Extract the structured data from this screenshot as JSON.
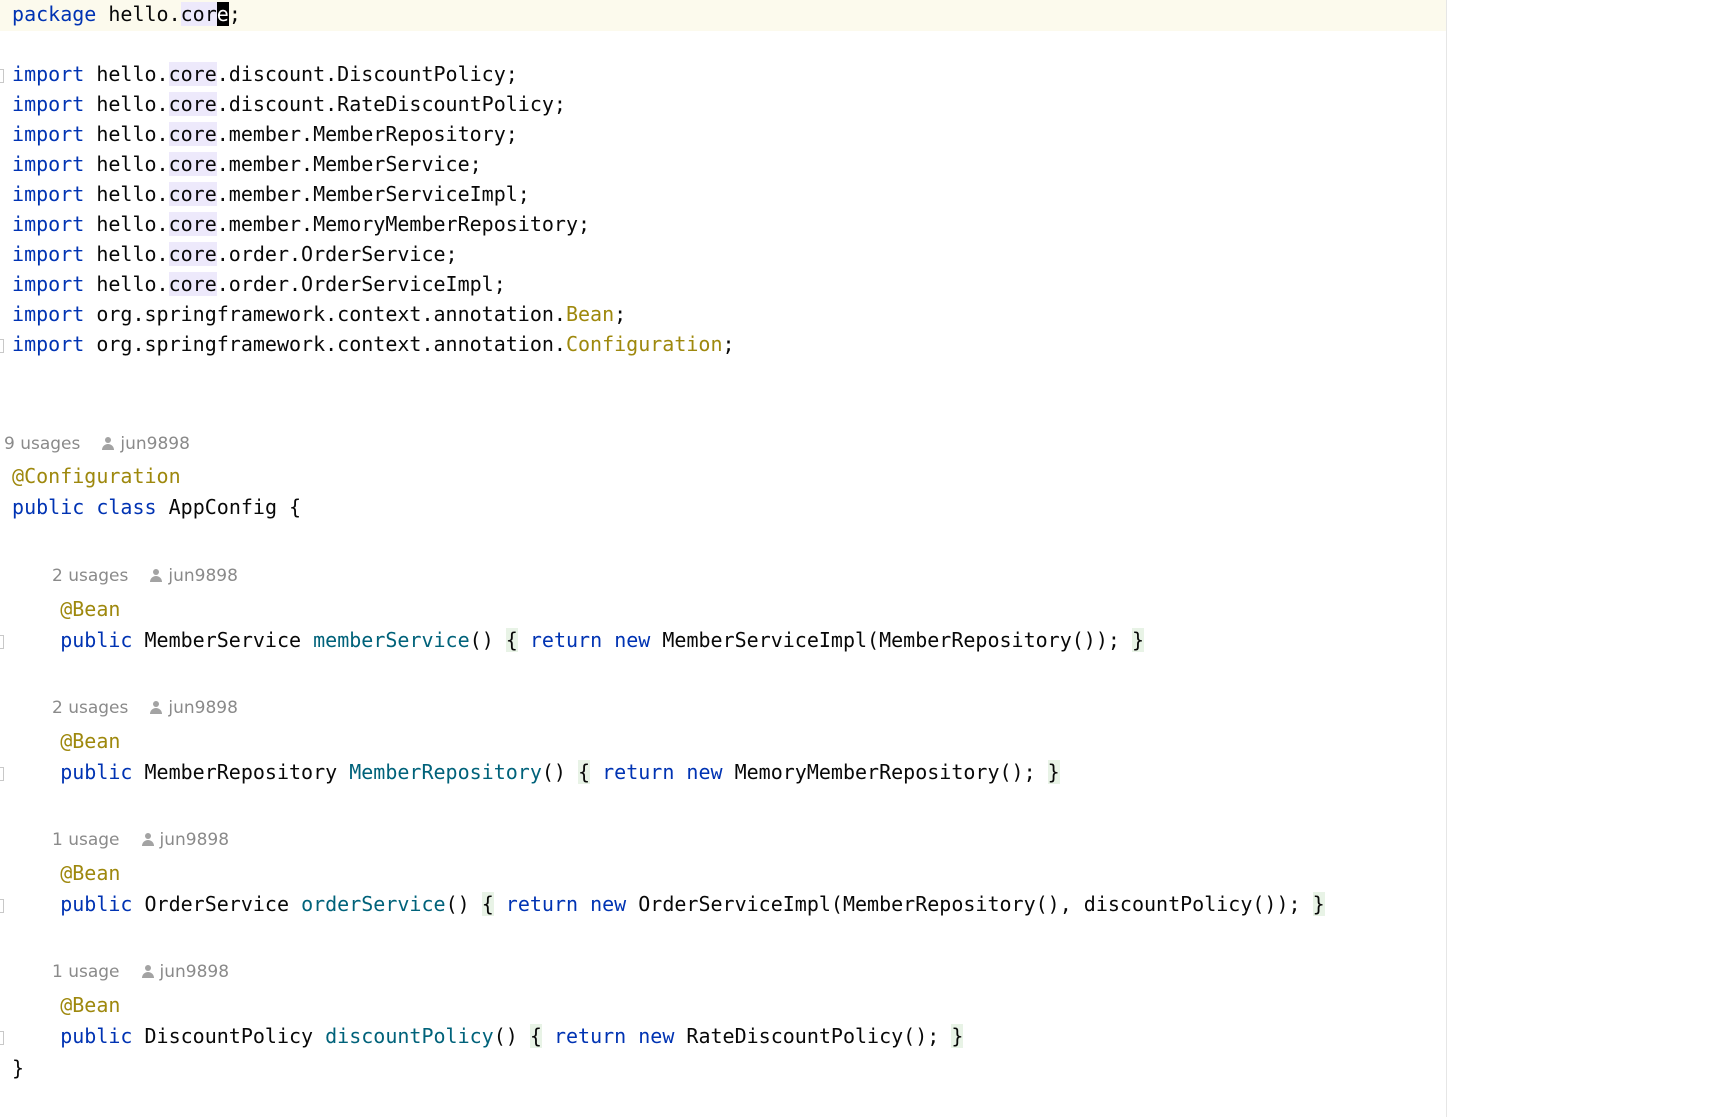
{
  "editor": {
    "package_kw": "package",
    "package_name_a": "hello.",
    "package_name_b": "cor",
    "package_caret": "e",
    "package_end": ";",
    "import_kw": "import",
    "imports": [
      {
        "a": "hello.",
        "b": "core",
        "c": ".discount.DiscountPolicy;"
      },
      {
        "a": "hello.",
        "b": "core",
        "c": ".discount.RateDiscountPolicy;"
      },
      {
        "a": "hello.",
        "b": "core",
        "c": ".member.MemberRepository;"
      },
      {
        "a": "hello.",
        "b": "core",
        "c": ".member.MemberService;"
      },
      {
        "a": "hello.",
        "b": "core",
        "c": ".member.MemberServiceImpl;"
      },
      {
        "a": "hello.",
        "b": "core",
        "c": ".member.MemoryMemberRepository;"
      },
      {
        "a": "hello.",
        "b": "core",
        "c": ".order.OrderService;"
      },
      {
        "a": "hello.",
        "b": "core",
        "c": ".order.OrderServiceImpl;"
      }
    ],
    "import_spring_prefix": "org.springframework.context.annotation.",
    "import_bean": "Bean",
    "import_configuration": "Configuration",
    "semicolon": ";",
    "class_usages": "9 usages",
    "author": "jun9898",
    "class_annotation": "@Configuration",
    "kw_public": "public",
    "kw_class": "class",
    "class_name": "AppConfig",
    "open_brace": "{",
    "close_brace": "}",
    "bean_annotation": "@Bean",
    "kw_return": "return",
    "kw_new": "new",
    "methods": [
      {
        "usages": "2 usages",
        "return_type": "MemberService",
        "name": "memberService",
        "params": "()",
        "body": "MemberServiceImpl(MemberRepository());"
      },
      {
        "usages": "2 usages",
        "return_type": "MemberRepository",
        "name": "MemberRepository",
        "params": "()",
        "body": "MemoryMemberRepository();"
      },
      {
        "usages": "1 usage",
        "return_type": "OrderService",
        "name": "orderService",
        "params": "()",
        "body": "OrderServiceImpl(MemberRepository(), discountPolicy());"
      },
      {
        "usages": "1 usage",
        "return_type": "DiscountPolicy",
        "name": "discountPolicy",
        "params": "()",
        "body": "RateDiscountPolicy();"
      }
    ]
  }
}
